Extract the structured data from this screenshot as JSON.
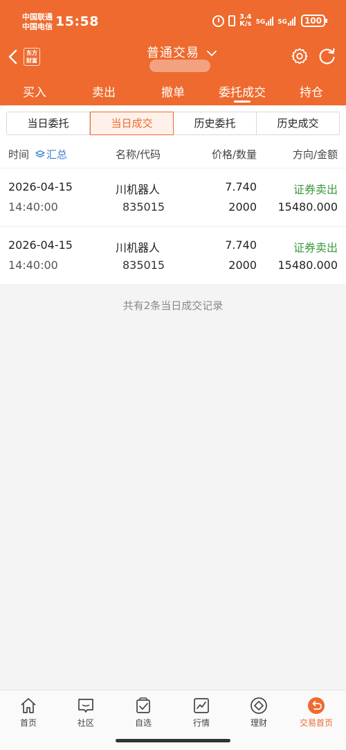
{
  "status_bar": {
    "carrier1": "中国联通",
    "carrier2": "中国电信",
    "time": "15:58",
    "speed_value": "3.4",
    "speed_unit": "K/s",
    "net1": "5G",
    "net2": "5G",
    "battery": "100"
  },
  "nav": {
    "logo_line1": "东方",
    "logo_line2": "财富",
    "title": "普通交易"
  },
  "trade_tabs": [
    "买入",
    "卖出",
    "撤单",
    "委托成交",
    "持仓"
  ],
  "segments": [
    "当日委托",
    "当日成交",
    "历史委托",
    "历史成交"
  ],
  "table": {
    "headers": {
      "time": "时间",
      "summary": "汇总",
      "name": "名称/代码",
      "price": "价格/数量",
      "direction": "方向/金额"
    },
    "rows": [
      {
        "date": "2026-04-15",
        "time": "14:40:00",
        "name": "川机器人",
        "code": "835015",
        "price": "7.740",
        "quantity": "2000",
        "direction": "证券卖出",
        "amount": "15480.000"
      },
      {
        "date": "2026-04-15",
        "time": "14:40:00",
        "name": "川机器人",
        "code": "835015",
        "price": "7.740",
        "quantity": "2000",
        "direction": "证券卖出",
        "amount": "15480.000"
      }
    ]
  },
  "footer_note": "共有2条当日成交记录",
  "bottom_nav": [
    "首页",
    "社区",
    "自选",
    "行情",
    "理财",
    "交易首页"
  ],
  "colors": {
    "accent": "#ee6a2e",
    "sell_green": "#3c9a3c",
    "link_blue": "#3b7fd0"
  }
}
